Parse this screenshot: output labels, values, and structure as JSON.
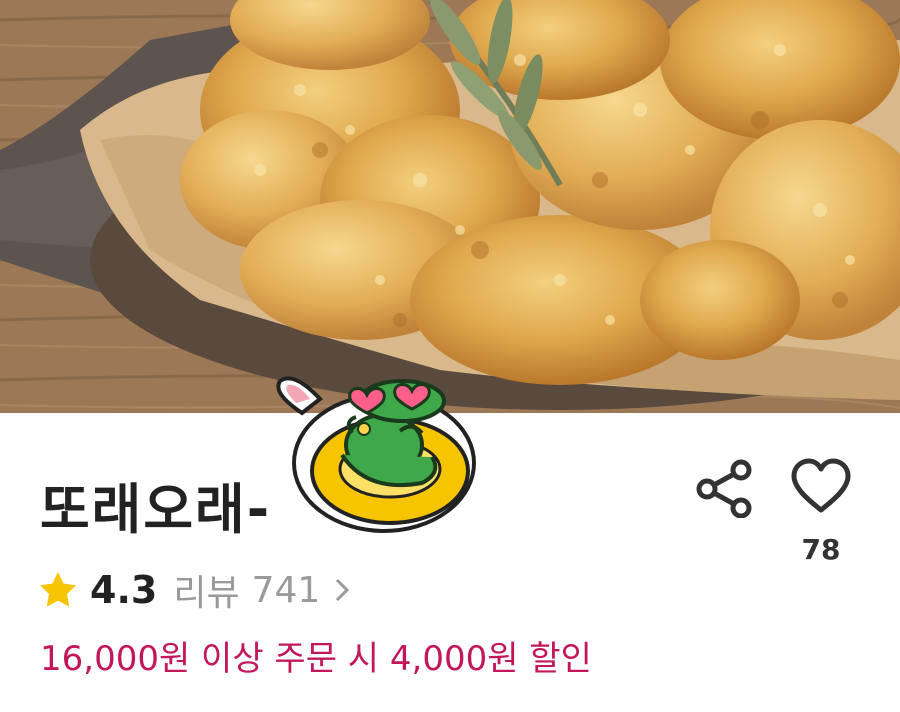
{
  "hero": {
    "image": "fried-chicken-photo"
  },
  "store": {
    "name": "또래오래-",
    "badge": "frog-mascot-sticker"
  },
  "actions": {
    "share_icon": "share-icon",
    "like_icon": "heart-outline-icon",
    "like_count": "78"
  },
  "rating": {
    "icon": "star-icon",
    "star_color": "#f6c400",
    "value": "4.3",
    "review_label": "리뷰",
    "review_count": "741",
    "chevron_icon": "chevron-right-icon"
  },
  "promo": {
    "text": "16,000원 이상 주문 시 4,000원 할인",
    "color": "#c2185b"
  }
}
